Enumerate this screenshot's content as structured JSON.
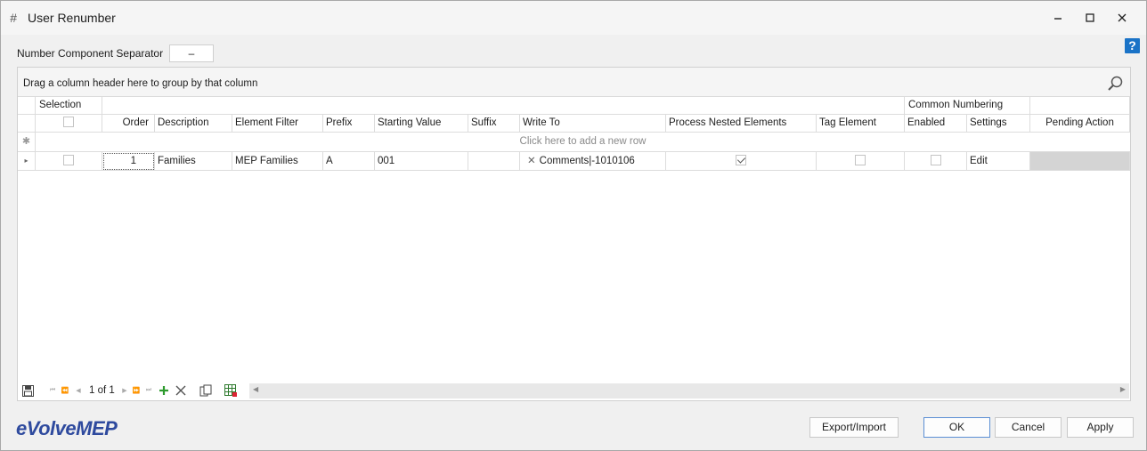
{
  "window": {
    "title": "User Renumber",
    "icon": "hash-icon"
  },
  "separator": {
    "label": "Number Component Separator",
    "value": "–"
  },
  "grid": {
    "group_panel_text": "Drag a column header here to group by that column",
    "bands": {
      "selection": "Selection",
      "common_numbering": "Common Numbering"
    },
    "columns": {
      "order": "Order",
      "description": "Description",
      "element_filter": "Element Filter",
      "prefix": "Prefix",
      "starting_value": "Starting Value",
      "suffix": "Suffix",
      "write_to": "Write To",
      "process_nested": "Process Nested Elements",
      "tag_element": "Tag Element",
      "enabled": "Enabled",
      "settings": "Settings",
      "pending_action": "Pending Action"
    },
    "new_row_text": "Click here to add a new row",
    "rows": [
      {
        "selected": false,
        "order": "1",
        "description": "Families",
        "element_filter": "MEP Families",
        "prefix": "A",
        "starting_value": "001",
        "suffix": "",
        "write_to": "Comments|-1010106",
        "process_nested": true,
        "tag_element": false,
        "enabled": false,
        "settings": "Edit",
        "pending_action": ""
      }
    ],
    "navigator": {
      "page_text": "1 of 1"
    }
  },
  "footer": {
    "logo": "eVolveMEP",
    "export_import": "Export/Import",
    "ok": "OK",
    "cancel": "Cancel",
    "apply": "Apply"
  },
  "colors": {
    "accent": "#1a73c7",
    "logo": "#2e4a9e",
    "add_green": "#2e9b2e"
  }
}
